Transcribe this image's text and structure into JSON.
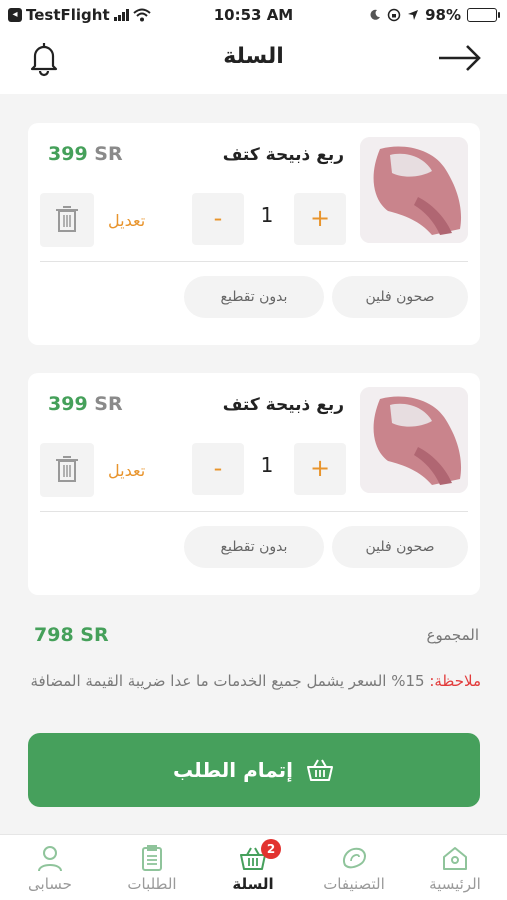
{
  "status_bar": {
    "back_app": "TestFlight",
    "time": "10:53 AM",
    "battery": "98%"
  },
  "header": {
    "title": "السلة"
  },
  "items": [
    {
      "name": "ربع ذبيحة كتف",
      "price_value": "399",
      "currency": "SR",
      "quantity": "1",
      "plus": "+",
      "minus": "-",
      "edit_label": "تعديل",
      "options": [
        "صحون فلين",
        "بدون تقطيع"
      ]
    },
    {
      "name": "ربع ذبيحة كتف",
      "price_value": "399",
      "currency": "SR",
      "quantity": "1",
      "plus": "+",
      "minus": "-",
      "edit_label": "تعديل",
      "options": [
        "صحون فلين",
        "بدون تقطيع"
      ]
    }
  ],
  "summary": {
    "total_label": "المجموع",
    "total_value": "798 SR",
    "note_label": "ملاحظة:",
    "note_text": " 15% السعر يشمل جميع الخدمات ما عدا ضريبة القيمة المضافة"
  },
  "checkout": {
    "label": "إتمام الطلب"
  },
  "tabbar": {
    "home": "الرئيسية",
    "categories": "التصنيفات",
    "cart": "السلة",
    "cart_badge": "2",
    "orders": "الطلبات",
    "account": "حسابى"
  },
  "colors": {
    "accent_green": "#46a05c",
    "accent_orange": "#e8942c",
    "badge_red": "#e2322f"
  }
}
